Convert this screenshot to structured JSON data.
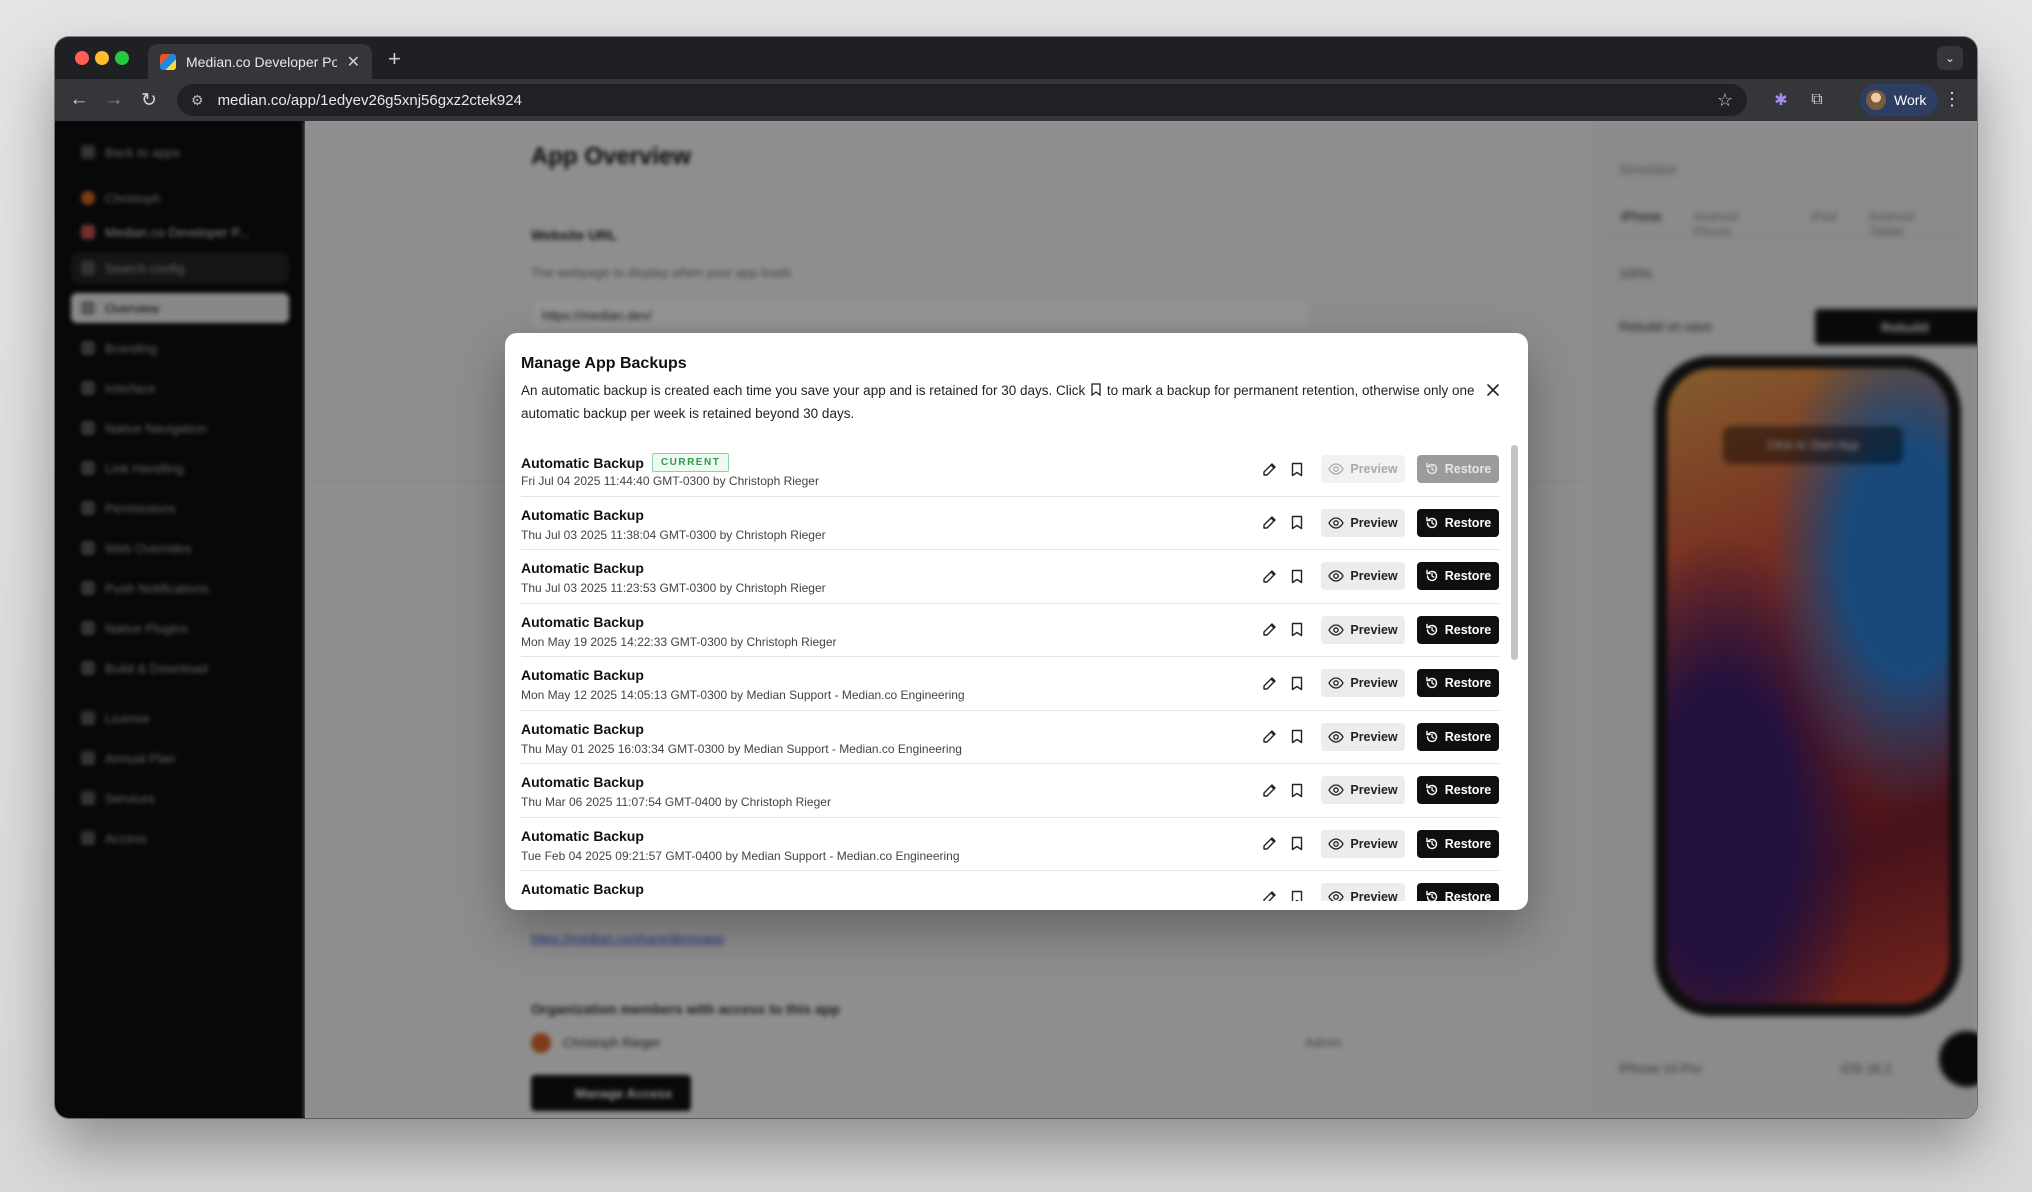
{
  "browser": {
    "tab_title": "Median.co Developer Portal -",
    "url": "median.co/app/1edyev26g5xnj56gxz2ctek924",
    "profile_label": "Work"
  },
  "background_app": {
    "sidebar_items": [
      "Back to apps",
      "Christoph",
      "Median.co Developer P...",
      "Search config",
      "Overview",
      "Branding",
      "Interface",
      "Native Navigation",
      "Link Handling",
      "Permissions",
      "Web Overrides",
      "Push Notifications",
      "Native Plugins",
      "Build & Download",
      "License",
      "Annual Plan",
      "Services",
      "Access"
    ],
    "main_title": "App Overview",
    "website_url_label": "Website URL",
    "website_url_desc": "The webpage to display when your app loads",
    "website_url_value": "https://median.dev/",
    "share_link": "https://median.co/share/demoapp",
    "members_label": "Organization members with access to this app",
    "member_name": "Christoph Rieger",
    "member_role": "Admin",
    "manage_access": "Manage Access",
    "preview_label": "Simulator",
    "preview_tabs": [
      "iPhone",
      "Android Phone",
      "iPad",
      "Android Tablet"
    ],
    "zoom": "100%",
    "rebuild_on_save": "Rebuild on save",
    "rebuild_btn": "Rebuild",
    "tap_to_start": "Click to Start App",
    "device": "iPhone 14 Pro",
    "os_version": "iOS 16.2"
  },
  "modal": {
    "title": "Manage App Backups",
    "description_before": "An automatic backup is created each time you save your app and is retained for 30 days. Click",
    "description_after": "to mark a backup for permanent retention, otherwise only one automatic backup per week is retained beyond 30 days.",
    "preview_label": "Preview",
    "restore_label": "Restore",
    "current_badge": "CURRENT",
    "backups": [
      {
        "name": "Automatic Backup",
        "meta": "Fri Jul 04 2025 11:44:40 GMT-0300 by Christoph Rieger",
        "current": true
      },
      {
        "name": "Automatic Backup",
        "meta": "Thu Jul 03 2025 11:38:04 GMT-0300 by Christoph Rieger",
        "current": false
      },
      {
        "name": "Automatic Backup",
        "meta": "Thu Jul 03 2025 11:23:53 GMT-0300 by Christoph Rieger",
        "current": false
      },
      {
        "name": "Automatic Backup",
        "meta": "Mon May 19 2025 14:22:33 GMT-0300 by Christoph Rieger",
        "current": false
      },
      {
        "name": "Automatic Backup",
        "meta": "Mon May 12 2025 14:05:13 GMT-0300 by Median Support - Median.co Engineering",
        "current": false
      },
      {
        "name": "Automatic Backup",
        "meta": "Thu May 01 2025 16:03:34 GMT-0300 by Median Support - Median.co Engineering",
        "current": false
      },
      {
        "name": "Automatic Backup",
        "meta": "Thu Mar 06 2025 11:07:54 GMT-0400 by Christoph Rieger",
        "current": false
      },
      {
        "name": "Automatic Backup",
        "meta": "Tue Feb 04 2025 09:21:57 GMT-0400 by Median Support - Median.co Engineering",
        "current": false
      },
      {
        "name": "Automatic Backup",
        "meta": "",
        "current": false
      }
    ]
  },
  "colors": {
    "accent_dark": "#0f0f0f",
    "badge_green": "#2f9a4e"
  }
}
